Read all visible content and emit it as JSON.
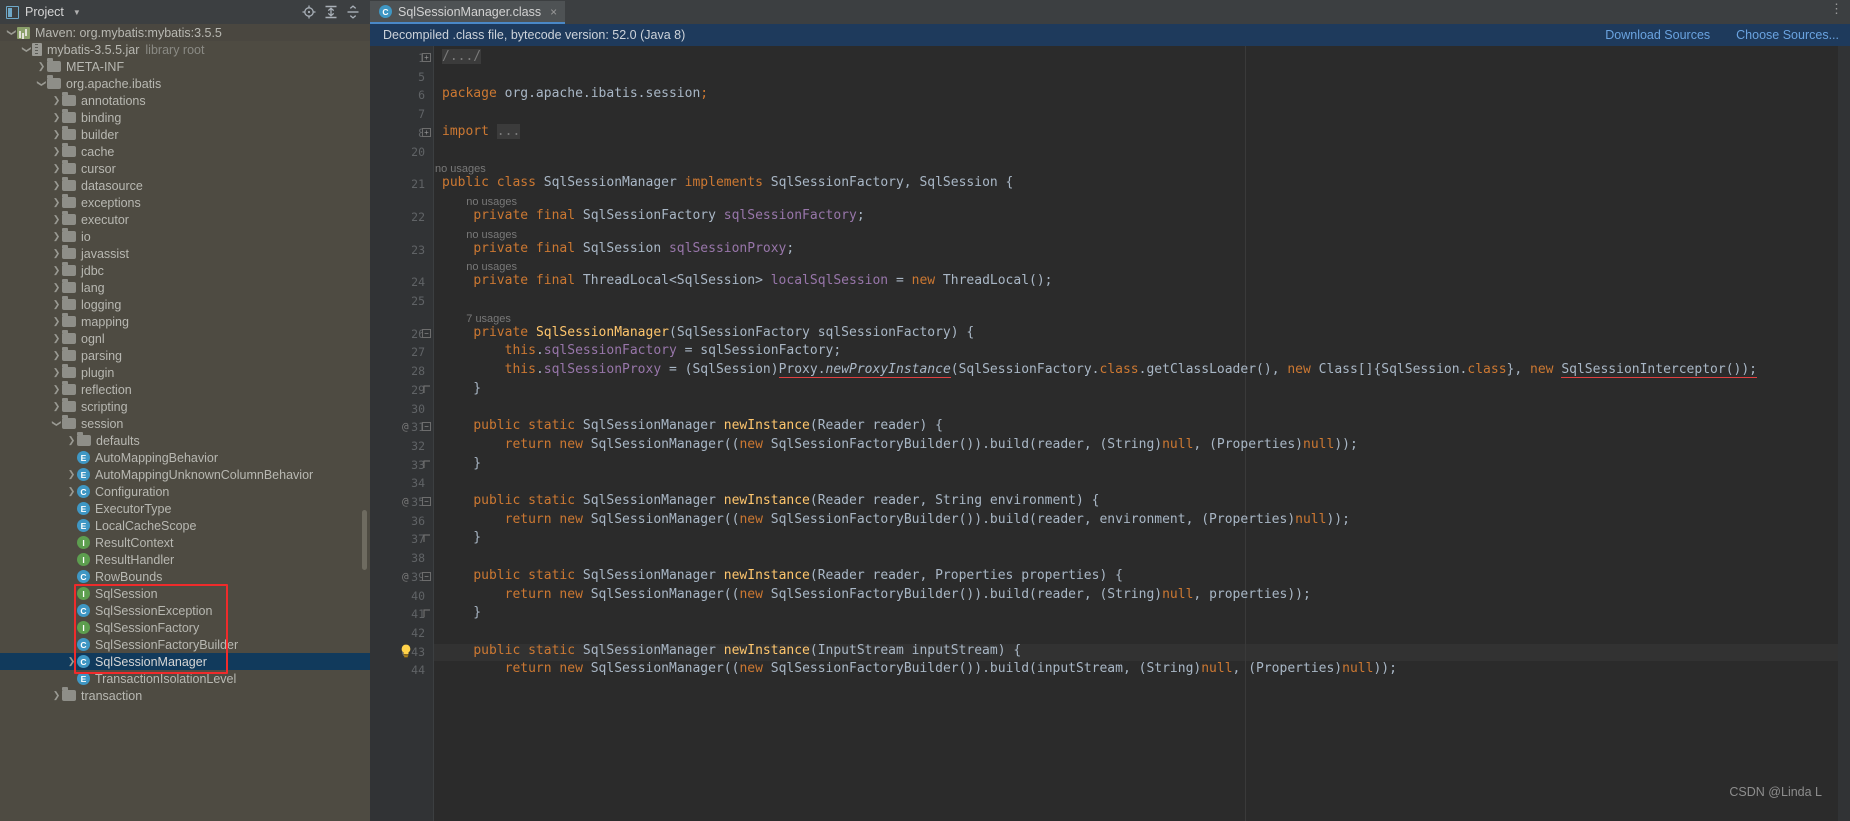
{
  "project_panel": {
    "title": "Project",
    "icons": [
      "locate-icon",
      "expand-all-icon",
      "collapse-all-icon",
      "settings-icon",
      "minimize-icon"
    ],
    "tree": [
      {
        "indent": 0,
        "arrow": "down",
        "icon": "maven-icon",
        "label": "Maven: org.mybatis:mybatis:3.5.5",
        "sub": "",
        "state": "header"
      },
      {
        "indent": 1,
        "arrow": "down",
        "icon": "jar-icon",
        "label": "mybatis-3.5.5.jar",
        "sub": "library root",
        "state": ""
      },
      {
        "indent": 2,
        "arrow": "right",
        "icon": "folder-icon",
        "label": "META-INF",
        "sub": "",
        "state": ""
      },
      {
        "indent": 2,
        "arrow": "down",
        "icon": "folder-icon",
        "label": "org.apache.ibatis",
        "sub": "",
        "state": ""
      },
      {
        "indent": 3,
        "arrow": "right",
        "icon": "folder-icon",
        "label": "annotations",
        "sub": "",
        "state": ""
      },
      {
        "indent": 3,
        "arrow": "right",
        "icon": "folder-icon",
        "label": "binding",
        "sub": "",
        "state": ""
      },
      {
        "indent": 3,
        "arrow": "right",
        "icon": "folder-icon",
        "label": "builder",
        "sub": "",
        "state": ""
      },
      {
        "indent": 3,
        "arrow": "right",
        "icon": "folder-icon",
        "label": "cache",
        "sub": "",
        "state": ""
      },
      {
        "indent": 3,
        "arrow": "right",
        "icon": "folder-icon",
        "label": "cursor",
        "sub": "",
        "state": ""
      },
      {
        "indent": 3,
        "arrow": "right",
        "icon": "folder-icon",
        "label": "datasource",
        "sub": "",
        "state": ""
      },
      {
        "indent": 3,
        "arrow": "right",
        "icon": "folder-icon",
        "label": "exceptions",
        "sub": "",
        "state": ""
      },
      {
        "indent": 3,
        "arrow": "right",
        "icon": "folder-icon",
        "label": "executor",
        "sub": "",
        "state": ""
      },
      {
        "indent": 3,
        "arrow": "right",
        "icon": "folder-icon",
        "label": "io",
        "sub": "",
        "state": ""
      },
      {
        "indent": 3,
        "arrow": "right",
        "icon": "folder-icon",
        "label": "javassist",
        "sub": "",
        "state": ""
      },
      {
        "indent": 3,
        "arrow": "right",
        "icon": "folder-icon",
        "label": "jdbc",
        "sub": "",
        "state": ""
      },
      {
        "indent": 3,
        "arrow": "right",
        "icon": "folder-icon",
        "label": "lang",
        "sub": "",
        "state": ""
      },
      {
        "indent": 3,
        "arrow": "right",
        "icon": "folder-icon",
        "label": "logging",
        "sub": "",
        "state": ""
      },
      {
        "indent": 3,
        "arrow": "right",
        "icon": "folder-icon",
        "label": "mapping",
        "sub": "",
        "state": ""
      },
      {
        "indent": 3,
        "arrow": "right",
        "icon": "folder-icon",
        "label": "ognl",
        "sub": "",
        "state": ""
      },
      {
        "indent": 3,
        "arrow": "right",
        "icon": "folder-icon",
        "label": "parsing",
        "sub": "",
        "state": ""
      },
      {
        "indent": 3,
        "arrow": "right",
        "icon": "folder-icon",
        "label": "plugin",
        "sub": "",
        "state": ""
      },
      {
        "indent": 3,
        "arrow": "right",
        "icon": "folder-icon",
        "label": "reflection",
        "sub": "",
        "state": ""
      },
      {
        "indent": 3,
        "arrow": "right",
        "icon": "folder-icon",
        "label": "scripting",
        "sub": "",
        "state": ""
      },
      {
        "indent": 3,
        "arrow": "down",
        "icon": "folder-icon",
        "label": "session",
        "sub": "",
        "state": ""
      },
      {
        "indent": 4,
        "arrow": "right",
        "icon": "folder-icon",
        "label": "defaults",
        "sub": "",
        "state": ""
      },
      {
        "indent": 4,
        "arrow": "none",
        "icon": "enum-icon",
        "label": "AutoMappingBehavior",
        "sub": "",
        "state": ""
      },
      {
        "indent": 4,
        "arrow": "right",
        "icon": "enum-icon",
        "label": "AutoMappingUnknownColumnBehavior",
        "sub": "",
        "state": ""
      },
      {
        "indent": 4,
        "arrow": "right",
        "icon": "class-icon",
        "label": "Configuration",
        "sub": "",
        "state": ""
      },
      {
        "indent": 4,
        "arrow": "none",
        "icon": "enum-icon",
        "label": "ExecutorType",
        "sub": "",
        "state": ""
      },
      {
        "indent": 4,
        "arrow": "none",
        "icon": "enum-icon",
        "label": "LocalCacheScope",
        "sub": "",
        "state": ""
      },
      {
        "indent": 4,
        "arrow": "none",
        "icon": "interface-icon",
        "label": "ResultContext",
        "sub": "",
        "state": ""
      },
      {
        "indent": 4,
        "arrow": "none",
        "icon": "interface-icon",
        "label": "ResultHandler",
        "sub": "",
        "state": ""
      },
      {
        "indent": 4,
        "arrow": "none",
        "icon": "class-icon",
        "label": "RowBounds",
        "sub": "",
        "state": ""
      },
      {
        "indent": 4,
        "arrow": "none",
        "icon": "interface-icon",
        "label": "SqlSession",
        "sub": "",
        "state": ""
      },
      {
        "indent": 4,
        "arrow": "none",
        "icon": "class-icon",
        "label": "SqlSessionException",
        "sub": "",
        "state": ""
      },
      {
        "indent": 4,
        "arrow": "none",
        "icon": "interface-icon",
        "label": "SqlSessionFactory",
        "sub": "",
        "state": ""
      },
      {
        "indent": 4,
        "arrow": "none",
        "icon": "class-icon",
        "label": "SqlSessionFactoryBuilder",
        "sub": "",
        "state": ""
      },
      {
        "indent": 4,
        "arrow": "right",
        "icon": "class-icon",
        "label": "SqlSessionManager",
        "sub": "",
        "state": "selected"
      },
      {
        "indent": 4,
        "arrow": "none",
        "icon": "enum-icon",
        "label": "TransactionIsolationLevel",
        "sub": "",
        "state": ""
      },
      {
        "indent": 3,
        "arrow": "right",
        "icon": "folder-icon",
        "label": "transaction",
        "sub": "",
        "state": ""
      }
    ],
    "highlight_box_color": "#ef2b2b",
    "selected_row_color": "#113a5c"
  },
  "editor": {
    "tab": {
      "label": "SqlSessionManager.class",
      "icon": "class-icon",
      "close": "×"
    },
    "tab_overflow_icon": "more-options-icon",
    "notification": {
      "text": "Decompiled .class file, bytecode version: 52.0 (Java 8)",
      "download_label": "Download Sources",
      "choose_label": "Choose Sources...",
      "background": "#1e3a5c",
      "link_color": "#6aa3e0"
    },
    "line_numbers": [
      "1",
      "5",
      "6",
      "7",
      "8",
      "20",
      "21",
      "22",
      "23",
      "24",
      "25",
      "26",
      "27",
      "28",
      "29",
      "30",
      "31",
      "32",
      "33",
      "34",
      "35",
      "36",
      "37",
      "38",
      "39",
      "40",
      "41",
      "42",
      "43",
      "44"
    ],
    "usage_hints": [
      {
        "text": "no usages",
        "line": "21"
      },
      {
        "text": "no usages",
        "line": "22"
      },
      {
        "text": "no usages",
        "line": "23"
      },
      {
        "text": "no usages",
        "line": "24"
      },
      {
        "text": "7 usages",
        "line": "26"
      }
    ],
    "gutter_markers": [
      "@",
      "@",
      "@",
      "@"
    ],
    "watermark": "CSDN @Linda L",
    "code_lines": [
      "/.../",
      "",
      "package org.apache.ibatis.session;",
      "",
      "import ...",
      "",
      "public class SqlSessionManager implements SqlSessionFactory, SqlSession {",
      "    private final SqlSessionFactory sqlSessionFactory;",
      "    private final SqlSession sqlSessionProxy;",
      "    private final ThreadLocal<SqlSession> localSqlSession = new ThreadLocal();",
      "",
      "    private SqlSessionManager(SqlSessionFactory sqlSessionFactory) {",
      "        this.sqlSessionFactory = sqlSessionFactory;",
      "        this.sqlSessionProxy = (SqlSession)Proxy.newProxyInstance(SqlSessionFactory.class.getClassLoader(), new Class[]{SqlSession.class}, new SqlSessionInterceptor());",
      "    }",
      "",
      "    public static SqlSessionManager newInstance(Reader reader) {",
      "        return new SqlSessionManager((new SqlSessionFactoryBuilder()).build(reader, (String)null, (Properties)null));",
      "    }",
      "",
      "    public static SqlSessionManager newInstance(Reader reader, String environment) {",
      "        return new SqlSessionManager((new SqlSessionFactoryBuilder()).build(reader, environment, (Properties)null));",
      "    }",
      "",
      "    public static SqlSessionManager newInstance(Reader reader, Properties properties) {",
      "        return new SqlSessionManager((new SqlSessionFactoryBuilder()).build(reader, (String)null, properties));",
      "    }",
      "",
      "    public static SqlSessionManager newInstance(InputStream inputStream) {",
      "        return new SqlSessionManager((new SqlSessionFactoryBuilder()).build(inputStream, (String)null, (Properties)null));"
    ]
  }
}
